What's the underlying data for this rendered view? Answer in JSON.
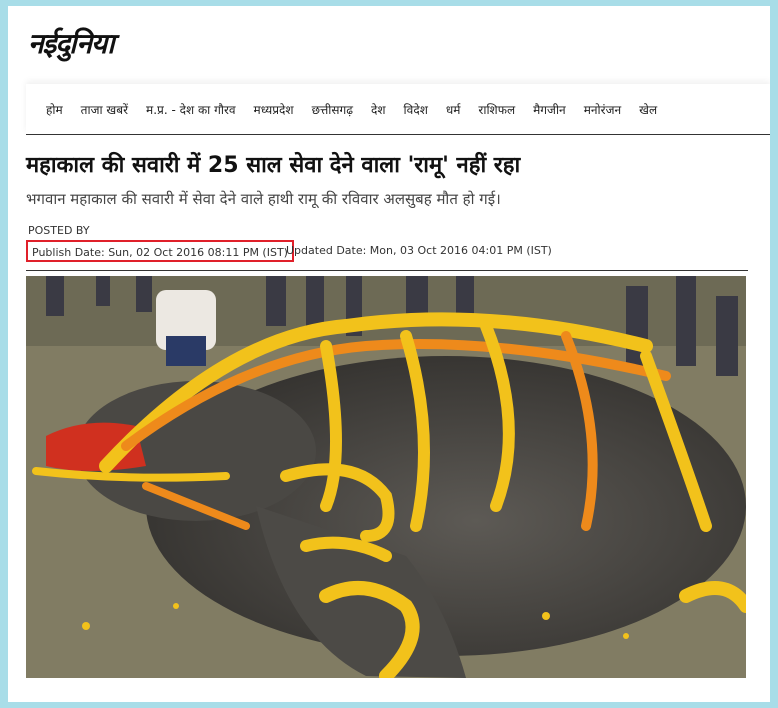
{
  "site": {
    "logo": "नईदुनिया"
  },
  "nav": {
    "items": [
      "होम",
      "ताजा खबरें",
      "म.प्र. - देश का गौरव",
      "मध्यप्रदेश",
      "छत्तीसगढ़",
      "देश",
      "विदेश",
      "धर्म",
      "राशिफल",
      "मैगजीन",
      "मनोरंजन",
      "खेल"
    ]
  },
  "article": {
    "headline": "महाकाल की सवारी में 25 साल सेवा देने वाला 'रामू' नहीं रहा",
    "subhead": "भगवान महाकाल की सवारी में सेवा देने वाले हाथी रामू की रविवार अलसुबह मौत हो गई।",
    "posted_by": "POSTED BY",
    "publish_date": "Publish Date: Sun, 02  Oct  2016  08:11 PM (IST)",
    "updated_date": "Updated Date: Mon,  03  Oct  2016  04:01 PM (IST)"
  },
  "colors": {
    "highlight_border": "#e0202a",
    "frame_bg": "#a8dde8"
  }
}
